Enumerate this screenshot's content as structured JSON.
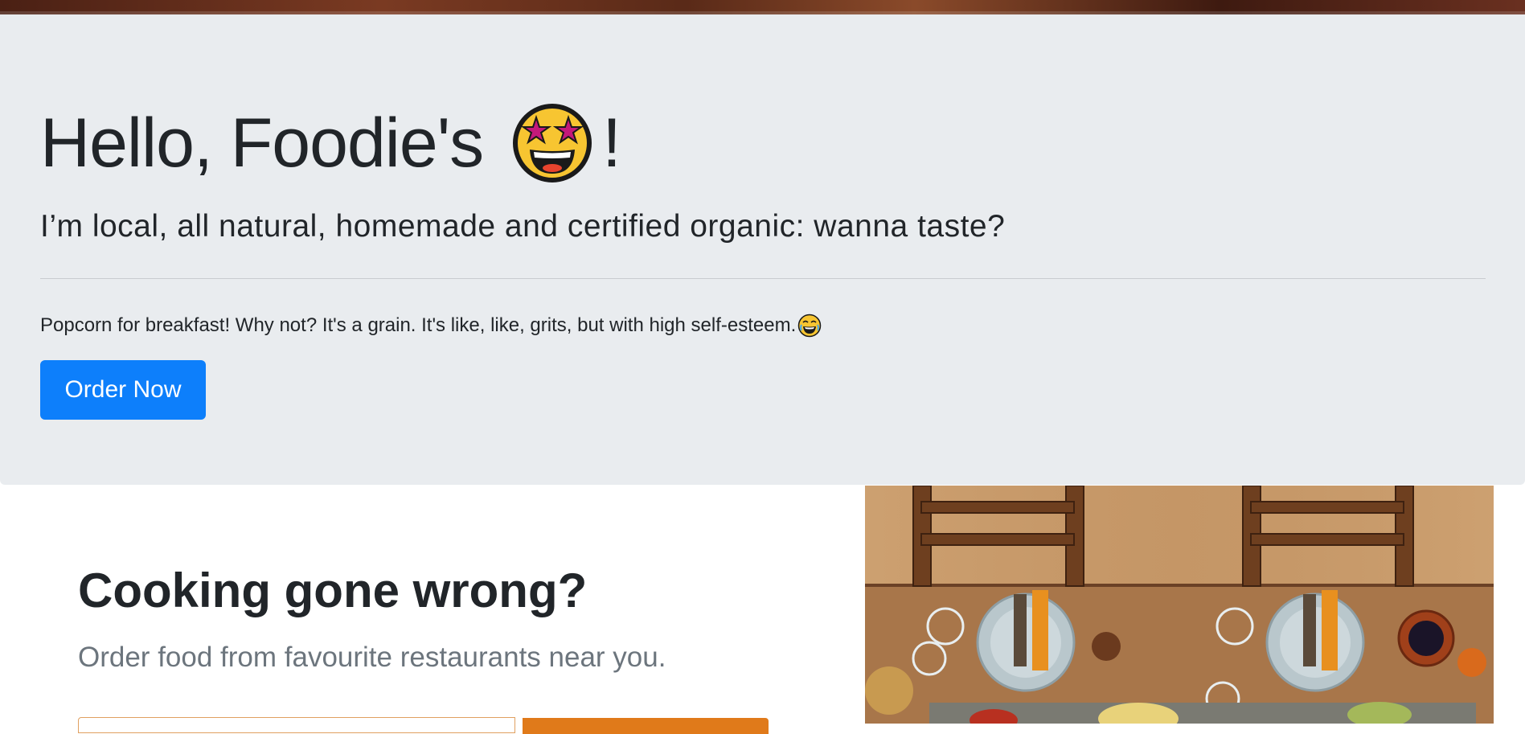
{
  "jumbotron": {
    "title_text": "Hello, Foodie's",
    "title_suffix": "!",
    "title_emoji": "star-struck-emoji-icon",
    "lead": "I’m local, all natural, homemade and certified organic: wanna taste?",
    "body": "Popcorn for breakfast! Why not? It's a grain. It's like, like, grits, but with high self-esteem.",
    "body_emoji": "laughing-emoji-icon",
    "button_label": "Order Now",
    "button_color": "#0d7ffb",
    "background": "#e9ecef"
  },
  "section": {
    "title": "Cooking gone wrong?",
    "subtitle": "Order food from favourite restaurants near you.",
    "accent_color": "#e07a1a",
    "image_icon": "dining-table-photo"
  }
}
